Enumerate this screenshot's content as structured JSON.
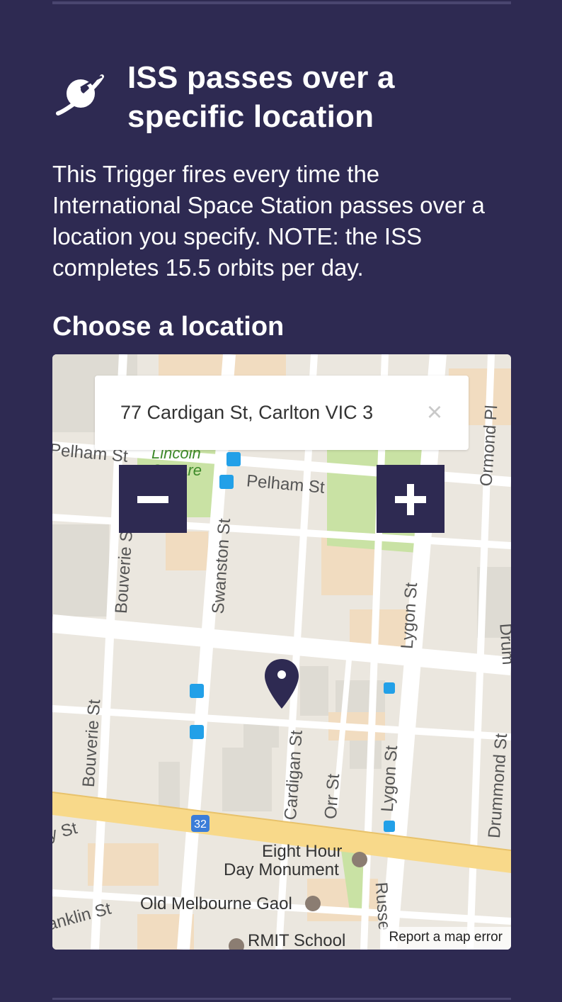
{
  "trigger": {
    "title": "ISS passes over a specific location",
    "description": "This Trigger fires every time the International Space Station passes over a location you specify. NOTE: the ISS completes 15.5 orbits per day.",
    "icon": "planet-icon"
  },
  "location_field": {
    "label": "Choose a location",
    "search_value": "77 Cardigan St, Carlton VIC 3",
    "clear_icon": "×",
    "zoom_out_icon": "minus-icon",
    "zoom_in_icon": "plus-icon"
  },
  "map": {
    "report_link": "Report a map error",
    "streets": {
      "pelham_left": "Pelham St",
      "pelham_right": "Pelham St",
      "swanston": "Swanston St",
      "bouverie_top": "Bouverie St",
      "bouverie_bottom": "Bouverie St",
      "cardigan": "Cardigan St",
      "lygon_top": "Lygon St",
      "lygon_bottom": "Lygon St",
      "orr": "Orr St",
      "ormond": "Ormond Pl",
      "drummond": "Drummond St",
      "drum_partial": "Drum",
      "franklin_partial": "anklin St",
      "russell_partial": "Russe",
      "y_st_partial": "y St"
    },
    "park_label": "Lincoln Square",
    "route_badge": "32",
    "pois": {
      "eight_hour_line1": "Eight Hour",
      "eight_hour_line2": "Day Monument",
      "old_gaol": "Old Melbourne Gaol",
      "rmit": "RMIT School"
    },
    "colors": {
      "background": "#ebe7df",
      "park": "#c9e2a4",
      "main_road": "#f8d98a",
      "accent": "#2e2a52"
    }
  }
}
